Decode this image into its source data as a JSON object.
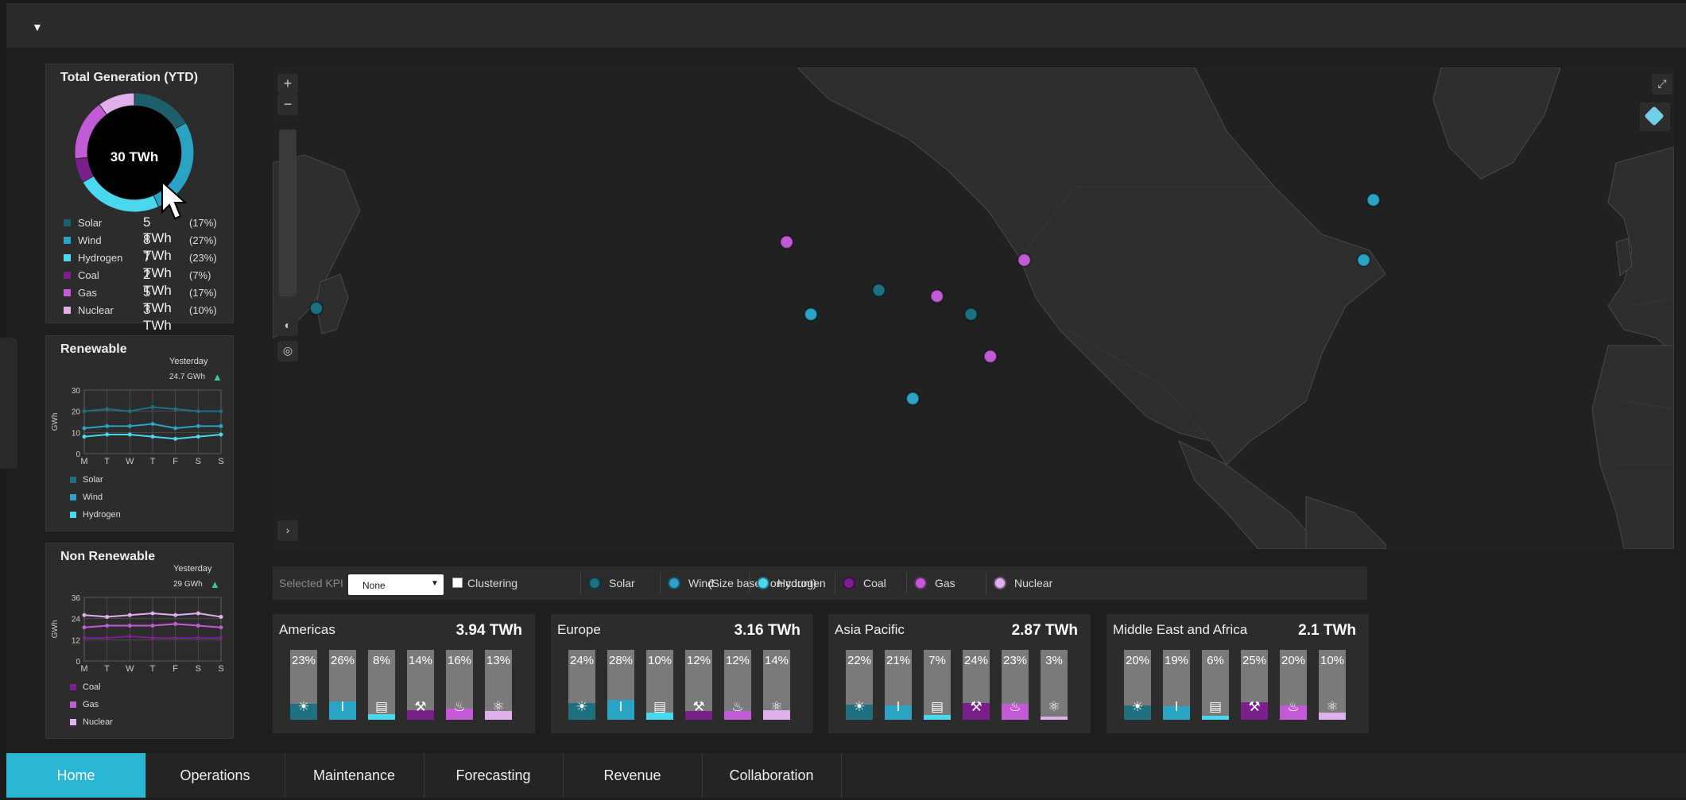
{
  "total_generation": {
    "title": "Total Generation (YTD)",
    "center": "30 TWh",
    "items": [
      {
        "name": "Solar",
        "value": "5 TWh",
        "pct": "(17%)",
        "color": "#1e5f6e"
      },
      {
        "name": "Wind",
        "value": "8 TWh",
        "pct": "(27%)",
        "color": "#2aa3c4"
      },
      {
        "name": "Hydrogen",
        "value": "7 TWh",
        "pct": "(23%)",
        "color": "#4ad8ee"
      },
      {
        "name": "Coal",
        "value": "2 TWh",
        "pct": "(7%)",
        "color": "#7a1f8c"
      },
      {
        "name": "Gas",
        "value": "5 TWh",
        "pct": "(17%)",
        "color": "#c45bd6"
      },
      {
        "name": "Nuclear",
        "value": "3 TWh",
        "pct": "(10%)",
        "color": "#e0b0ec"
      }
    ]
  },
  "renewable": {
    "title": "Renewable",
    "yesterday_label": "Yesterday",
    "yesterday_value": "24.7 GWh",
    "ylabel": "GWh",
    "legend": [
      "Solar",
      "Wind",
      "Hydrogen"
    ]
  },
  "non_renewable": {
    "title": "Non Renewable",
    "yesterday_label": "Yesterday",
    "yesterday_value": "29 GWh",
    "ylabel": "GWh",
    "legend": [
      "Coal",
      "Gas",
      "Nuclear"
    ]
  },
  "chart_data": [
    {
      "type": "pie",
      "title": "Total Generation (YTD)",
      "categories": [
        "Solar",
        "Wind",
        "Hydrogen",
        "Coal",
        "Gas",
        "Nuclear"
      ],
      "values": [
        5,
        8,
        7,
        2,
        5,
        3
      ],
      "colors": [
        "#1e5f6e",
        "#2aa3c4",
        "#4ad8ee",
        "#7a1f8c",
        "#c45bd6",
        "#e0b0ec"
      ]
    },
    {
      "type": "line",
      "title": "Renewable",
      "ylabel": "GWh",
      "categories": [
        "M",
        "T",
        "W",
        "T",
        "F",
        "S",
        "S"
      ],
      "yticks": [
        0,
        10,
        20,
        30
      ],
      "ylim": [
        0,
        30
      ],
      "grid": true,
      "series": [
        {
          "name": "Solar",
          "values": [
            20,
            21,
            20,
            22,
            21,
            20,
            20
          ],
          "color": "#1e6f80"
        },
        {
          "name": "Wind",
          "values": [
            12,
            13,
            13,
            14,
            12,
            13,
            13
          ],
          "color": "#2aa3c4"
        },
        {
          "name": "Hydrogen",
          "values": [
            8,
            9,
            9,
            8,
            7,
            8,
            9
          ],
          "color": "#4ad8ee"
        }
      ]
    },
    {
      "type": "line",
      "title": "Non Renewable",
      "ylabel": "GWh",
      "categories": [
        "M",
        "T",
        "W",
        "T",
        "F",
        "S",
        "S"
      ],
      "yticks": [
        0,
        12,
        24,
        36
      ],
      "ylim": [
        0,
        36
      ],
      "grid": true,
      "series": [
        {
          "name": "Coal",
          "values": [
            13,
            13,
            14,
            13,
            13,
            13,
            13
          ],
          "color": "#7a1f8c"
        },
        {
          "name": "Gas",
          "values": [
            19,
            20,
            20,
            20,
            21,
            20,
            19
          ],
          "color": "#c45bd6"
        },
        {
          "name": "Nuclear",
          "values": [
            26,
            25,
            26,
            27,
            26,
            27,
            25
          ],
          "color": "#e0b0ec"
        }
      ]
    }
  ],
  "kpi": {
    "selected_label": "Selected KPI",
    "selected_value": "None",
    "clustering_label": "Clustering",
    "size_note": "(Size based on count)",
    "legend": [
      {
        "name": "Solar",
        "color": "#1e6f80"
      },
      {
        "name": "Wind",
        "color": "#2aa3c4"
      },
      {
        "name": "Hydrogen",
        "color": "#4ad8ee"
      },
      {
        "name": "Coal",
        "color": "#7a1f8c"
      },
      {
        "name": "Gas",
        "color": "#c45bd6"
      },
      {
        "name": "Nuclear",
        "color": "#e0b0ec"
      }
    ]
  },
  "regions": [
    {
      "name": "Americas",
      "value": "3.94",
      "unit": "TWh",
      "pcts": [
        "23%",
        "26%",
        "8%",
        "14%",
        "16%",
        "13%"
      ]
    },
    {
      "name": "Europe",
      "value": "3.16",
      "unit": "TWh",
      "pcts": [
        "24%",
        "28%",
        "10%",
        "12%",
        "12%",
        "14%"
      ]
    },
    {
      "name": "Asia Pacific",
      "value": "2.87",
      "unit": "TWh",
      "pcts": [
        "22%",
        "21%",
        "7%",
        "24%",
        "23%",
        "3%"
      ]
    },
    {
      "name": "Middle East and Africa",
      "value": "2.1",
      "unit": "TWh",
      "pcts": [
        "20%",
        "19%",
        "6%",
        "25%",
        "20%",
        "10%"
      ]
    }
  ],
  "source_icons": [
    "solar-panel-icon",
    "wind-turbine-icon",
    "hydrogen-plant-icon",
    "coal-mine-icon",
    "gas-flame-icon",
    "atom-icon"
  ],
  "source_colors": [
    "#1e6f80",
    "#2aa3c4",
    "#4ad8ee",
    "#7a1f8c",
    "#c45bd6",
    "#e0b0ec"
  ],
  "nav": [
    "Home",
    "Operations",
    "Maintenance",
    "Forecasting",
    "Revenue",
    "Collaboration"
  ],
  "map_markers": [
    {
      "type": "Hydrogen",
      "color": "#4ad8ee",
      "lat": 59,
      "lon": 18
    },
    {
      "type": "Wind",
      "color": "#2aa3c4",
      "lat": 53,
      "lon": -2
    },
    {
      "type": "Gas",
      "color": "#c45bd6",
      "lat": 52,
      "lon": 14
    },
    {
      "type": "Gas",
      "color": "#c45bd6",
      "lat": 49,
      "lon": 3
    },
    {
      "type": "Nuclear",
      "color": "#e0b0ec",
      "lat": 48,
      "lon": 20
    },
    {
      "type": "Wind",
      "color": "#2aa3c4",
      "lat": 43,
      "lon": -4
    },
    {
      "type": "Solar",
      "color": "#1e6f80",
      "lat": 42,
      "lon": 13
    },
    {
      "type": "Hydrogen",
      "color": "#4ad8ee",
      "lat": 37,
      "lon": 24
    },
    {
      "type": "Nuclear",
      "color": "#e0b0ec",
      "lat": 30,
      "lon": 32
    },
    {
      "type": "Wind",
      "color": "#2aa3c4",
      "lat": 18,
      "lon": 40
    },
    {
      "type": "Gas",
      "color": "#c45bd6",
      "lat": 4,
      "lon": 7
    },
    {
      "type": "Gas",
      "color": "#c45bd6",
      "lat": 46,
      "lon": -123
    },
    {
      "type": "Gas",
      "color": "#c45bd6",
      "lat": 43,
      "lon": -74
    },
    {
      "type": "Solar",
      "color": "#1e6f80",
      "lat": 38,
      "lon": -104
    },
    {
      "type": "Gas",
      "color": "#c45bd6",
      "lat": 37,
      "lon": -92
    },
    {
      "type": "Wind",
      "color": "#2aa3c4",
      "lat": 34,
      "lon": -118
    },
    {
      "type": "Solar",
      "color": "#1e6f80",
      "lat": 34,
      "lon": -85
    },
    {
      "type": "Gas",
      "color": "#c45bd6",
      "lat": 27,
      "lon": -81
    },
    {
      "type": "Wind",
      "color": "#2aa3c4",
      "lat": 20,
      "lon": -97
    },
    {
      "type": "Solar",
      "color": "#1e6f80",
      "lat": 35,
      "lon": 140
    }
  ]
}
